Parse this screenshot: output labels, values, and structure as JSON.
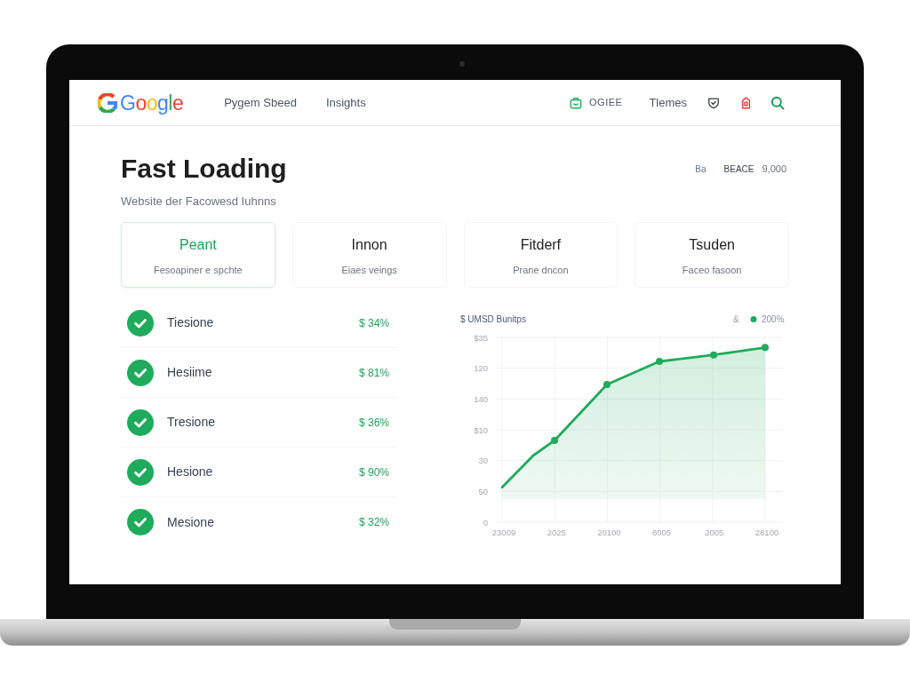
{
  "header": {
    "logo": "Google",
    "nav": [
      {
        "label": "Pygem Sbeed"
      },
      {
        "label": "Insights"
      }
    ],
    "account": {
      "label": "OGIEE"
    },
    "menu_link": "Tlemes"
  },
  "page": {
    "title": "Fast Loading",
    "subtitle": "Website der Facowesd Iuhnns",
    "stat": {
      "prefix": "Ba",
      "label": "BEACE",
      "value": "9,000"
    }
  },
  "cards": [
    {
      "title": "Peant",
      "subtitle": "Fesoapiner e spchte",
      "selected": true
    },
    {
      "title": "Innon",
      "subtitle": "Eiaes veings",
      "selected": false
    },
    {
      "title": "Fitderf",
      "subtitle": "Prane dncon",
      "selected": false
    },
    {
      "title": "Tsuden",
      "subtitle": "Faceo fasoon",
      "selected": false
    }
  ],
  "checklist": [
    {
      "name": "Tiesione",
      "value": "$ 34%",
      "checked": true
    },
    {
      "name": "Hesiime",
      "value": "$ 81%",
      "checked": true
    },
    {
      "name": "Tresione",
      "value": "$ 36%",
      "checked": true
    },
    {
      "name": "Hesione",
      "value": "$ 90%",
      "checked": true
    },
    {
      "name": "Mesione",
      "value": "$ 32%",
      "checked": true
    }
  ],
  "chart": {
    "title": "$ UMSD Bunitps",
    "legend_symbol": "&",
    "legend_label": "200%",
    "y_axis_labels": [
      "$35",
      "120",
      "140",
      "$10",
      "30",
      "50",
      "0"
    ],
    "x_axis_labels": [
      "23009",
      "2025",
      "20100",
      "8005",
      "2005",
      "28100"
    ]
  }
}
